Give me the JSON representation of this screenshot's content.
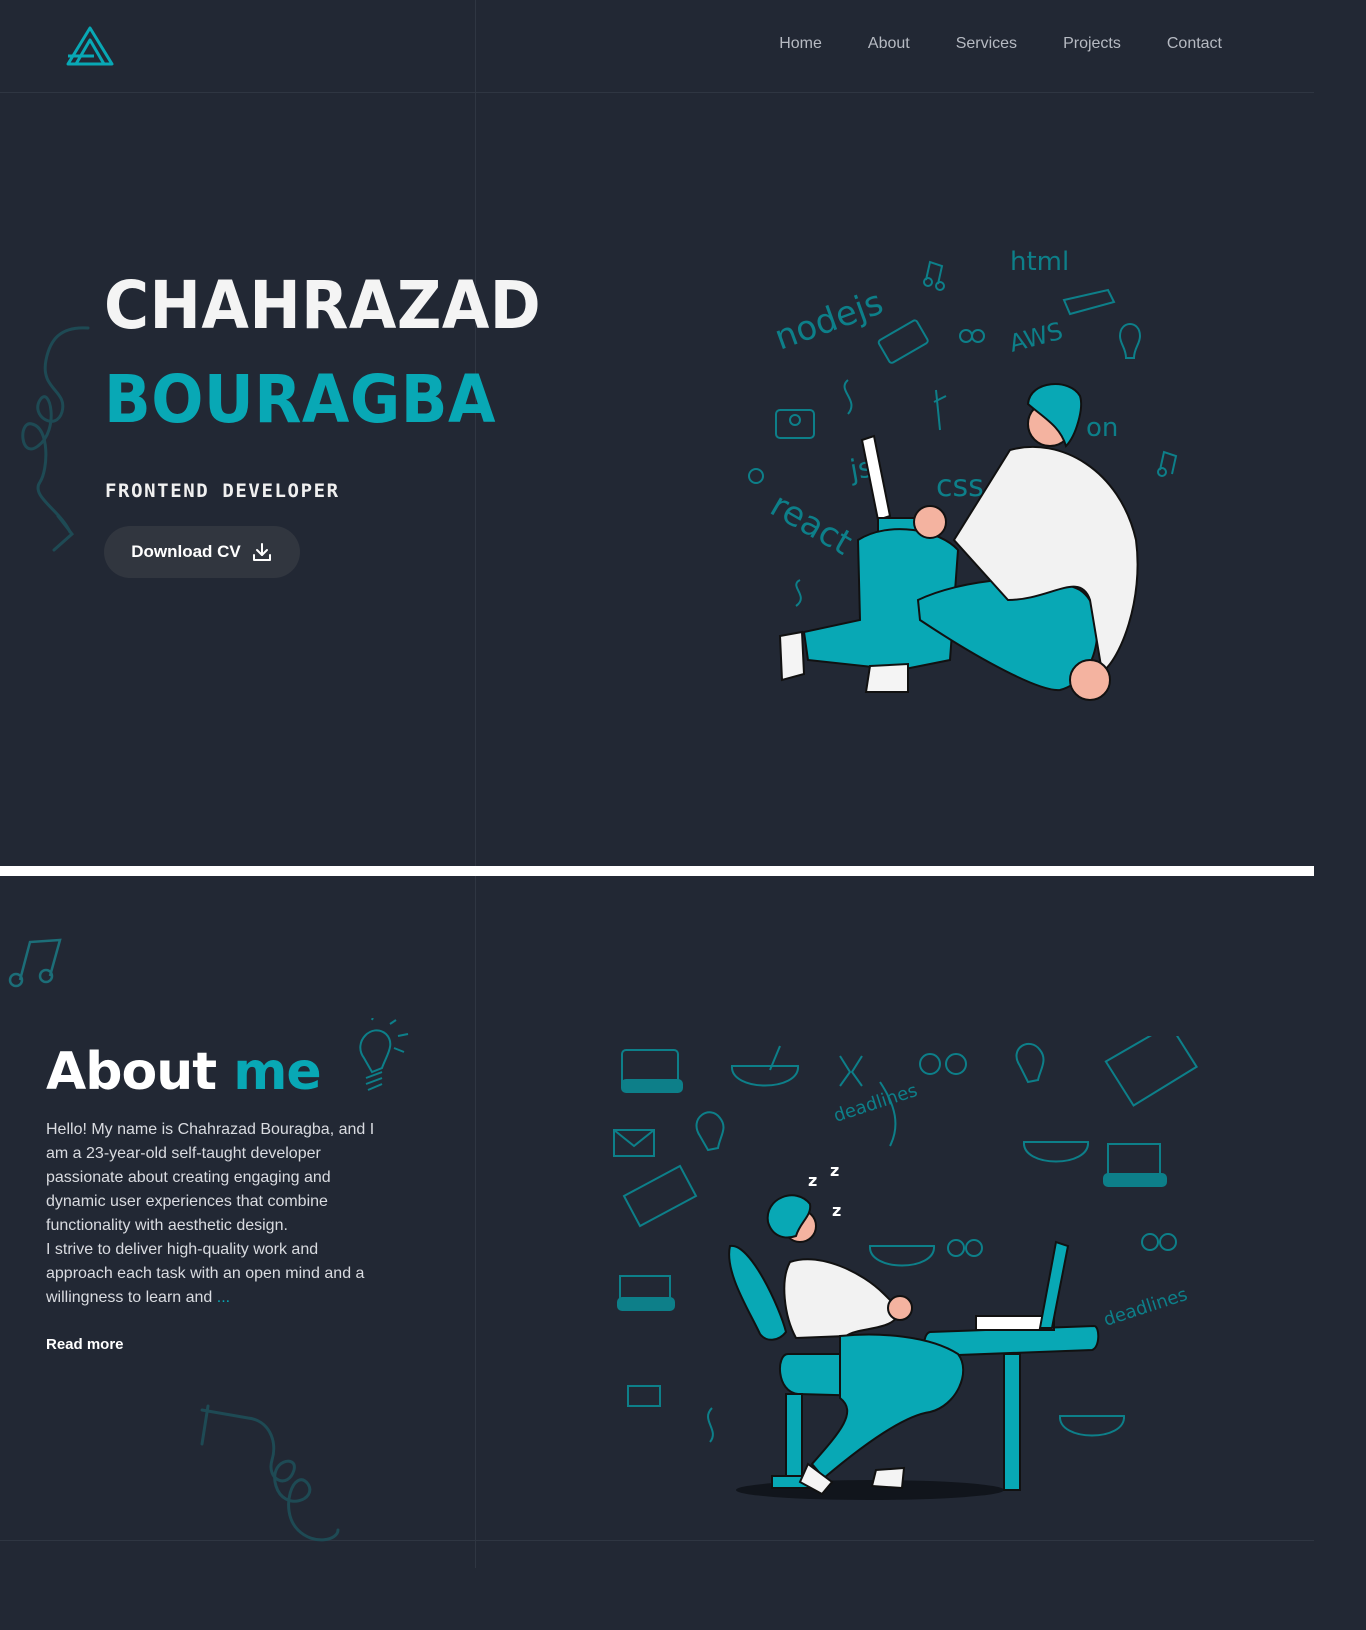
{
  "header": {
    "nav": [
      "Home",
      "About",
      "Services",
      "Projects",
      "Contact"
    ]
  },
  "hero": {
    "first_name": "CHAHRAZAD",
    "last_name": "BOURAGBA",
    "role": "FRONTEND DEVELOPER",
    "cv_label": "Download CV",
    "doodle_words": [
      "nodejs",
      "html",
      "AWS",
      "js",
      "css",
      "react",
      "on"
    ]
  },
  "about": {
    "title_main": "About",
    "title_accent": "me",
    "para1": "Hello! My name is Chahrazad Bouragba, and I am a 23-year-old self-taught developer passionate about creating engaging and dynamic user experiences that combine functionality with aesthetic design.",
    "para2": "I strive to deliver high-quality work and approach each task with an open mind and a willingness to learn and",
    "ellipsis": " ...",
    "read_more": "Read more",
    "doodle_words": [
      "deadlines",
      "deadlines"
    ]
  },
  "colors": {
    "background": "#222834",
    "accent": "#08a8b5",
    "button": "#31363f"
  },
  "icons": [
    "logo-icon",
    "download-icon"
  ]
}
